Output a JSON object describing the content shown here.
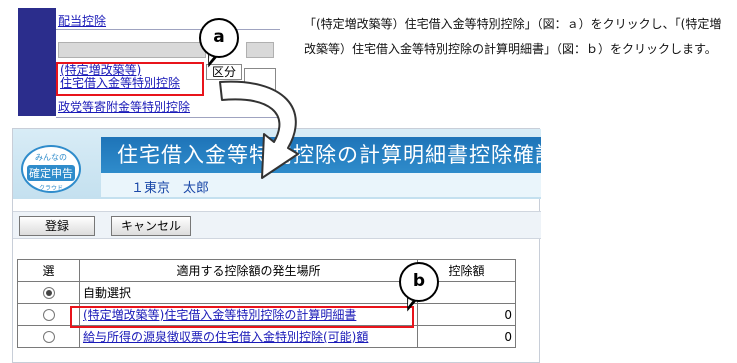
{
  "fragment": {
    "link_haito": "配当控除",
    "link_house_line1": "(特定増改築等)",
    "link_house_line2": "住宅借入金等特別控除",
    "kubun_label": "区分",
    "link_seito": "政党等寄附金等特別控除"
  },
  "callouts": {
    "a": "a",
    "b": "b"
  },
  "instruction": "「(特定増改築等）住宅借入金等特別控除」（図：ａ）をクリックし、「(特定増改築等）住宅借入金等特別控除の計算明細書」（図：ｂ）をクリックします。",
  "app": {
    "logo_top": "みんなの",
    "logo_main": "確定申告",
    "logo_bottom": "クラウド",
    "title": "住宅借入金等特別控除の計算明細書控除確認",
    "user": "１東京　太郎"
  },
  "toolbar": {
    "register_label": "登録",
    "cancel_label": "キャンセル"
  },
  "table": {
    "headers": [
      "選",
      "適用する控除額の発生場所",
      "控除額"
    ],
    "rows": [
      {
        "selected": true,
        "place": "自動選択",
        "link": false,
        "amount": ""
      },
      {
        "selected": false,
        "place": "(特定増改築等)住宅借入金等特別控除の計算明細書",
        "link": true,
        "amount": "0"
      },
      {
        "selected": false,
        "place": "給与所得の源泉徴収票の住宅借入金特別控除(可能)額",
        "link": true,
        "amount": "0"
      }
    ]
  },
  "colors": {
    "highlight": "#e8141b",
    "header_blue": "#1e74b8",
    "link": "#1a1ab8"
  }
}
